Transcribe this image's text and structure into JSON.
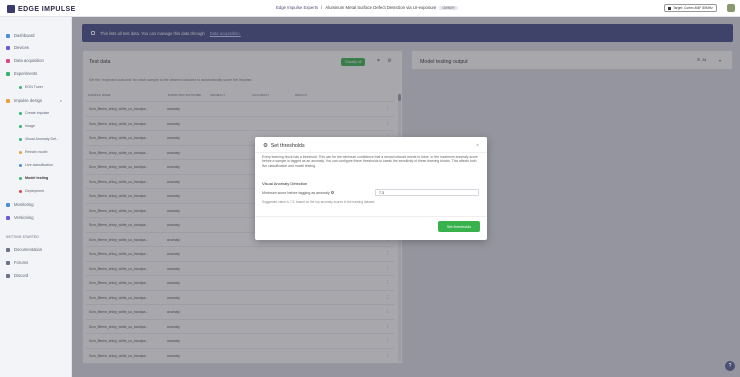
{
  "header": {
    "logo_text": "EDGE IMPULSE",
    "owner": "Edge Impulse Experts",
    "separator": "/",
    "project": "Aluminum Metal Surface Defect Detection via UI-exposure",
    "badge": "OWNER",
    "target": "Target: Cortex-M4F 80MHz"
  },
  "sidebar": {
    "items": [
      {
        "label": "Dashboard",
        "color": "#4a90d9"
      },
      {
        "label": "Devices",
        "color": "#6b5cd6"
      },
      {
        "label": "Data acquisition",
        "color": "#d94a8a"
      },
      {
        "label": "Experiments",
        "color": "#3cb371"
      },
      {
        "label": "EON Tuner",
        "color": "#3cb371"
      },
      {
        "label": "Impulse design",
        "color": "#e8a23c"
      },
      {
        "label": "Monitoring",
        "color": "#4a90d9"
      },
      {
        "label": "Versioning",
        "color": "#6b5cd6"
      },
      {
        "label": "Documentation",
        "color": "#6c7384"
      },
      {
        "label": "Forums",
        "color": "#6c7384"
      },
      {
        "label": "Discord",
        "color": "#6c7384"
      }
    ],
    "subitems": [
      {
        "label": "Create impulse",
        "color": "#3cb371"
      },
      {
        "label": "Image",
        "color": "#3cb371"
      },
      {
        "label": "Visual Anomaly Det...",
        "color": "#3cb371"
      },
      {
        "label": "Retrain model",
        "color": "#e8a23c"
      },
      {
        "label": "Live classification",
        "color": "#4a90d9"
      },
      {
        "label": "Model testing",
        "color": "#3cb371"
      },
      {
        "label": "Deployment",
        "color": "#d94a4a"
      }
    ],
    "section_label": "GETTING STARTED"
  },
  "notice": {
    "text": "This lists all test data. You can manage this data through",
    "link": "Data acquisition."
  },
  "test_panel": {
    "title": "Test data",
    "classify_label": "Classify all",
    "hint": "Set the 'expected outcome' for each sample to the desired outcome to automatically score the impulse.",
    "columns": [
      "SAMPLE NAME",
      "EXPECTED OUTCOME",
      "ANOMALY",
      "ACCURACY",
      "RESULT"
    ],
    "rows": [
      {
        "name": "Scm_filtrem_shiny_white_uu_bandpa...",
        "label": "anomaly"
      },
      {
        "name": "Scm_filtrem_shiny_white_uu_bandpa...",
        "label": "anomaly"
      },
      {
        "name": "Scm_filtrem_shiny_white_uu_bandpa...",
        "label": "anomaly"
      },
      {
        "name": "Scm_filtrem_shiny_white_uu_bandpa...",
        "label": "anomaly"
      },
      {
        "name": "Scm_filtrem_shiny_white_uu_bandpa...",
        "label": "anomaly"
      },
      {
        "name": "Scm_filtrem_shiny_white_uu_bandpa...",
        "label": "anomaly"
      },
      {
        "name": "Scm_filtrem_shiny_white_uu_bandpa...",
        "label": "anomaly"
      },
      {
        "name": "Scm_filtrem_shiny_white_uu_bandpa...",
        "label": "anomaly"
      },
      {
        "name": "Scm_filtrem_shiny_white_uu_bandpa...",
        "label": "anomaly"
      },
      {
        "name": "Scm_filtrem_shiny_white_uu_bandpa...",
        "label": "anomaly"
      },
      {
        "name": "Scm_filtrem_shiny_white_uu_bandpa...",
        "label": "anomaly"
      },
      {
        "name": "Scm_filtrem_shiny_white_uu_bandpa...",
        "label": "anomaly"
      },
      {
        "name": "Scm_filtrem_shiny_white_uu_bandpa...",
        "label": "anomaly"
      },
      {
        "name": "Scm_filtrem_shiny_white_uu_bandpa...",
        "label": "anomaly"
      },
      {
        "name": "Scm_filtrem_shiny_white_uu_bandpa...",
        "label": "anomaly"
      },
      {
        "name": "Scm_filtrem_shiny_white_uu_bandpa...",
        "label": "anomaly"
      },
      {
        "name": "Scm_filtrem_shiny_white_uu_bandpa...",
        "label": "anomaly"
      },
      {
        "name": "Scm_filtrem_shiny_white_uu_bandpa...",
        "label": "anomaly"
      }
    ]
  },
  "output_panel": {
    "title": "Model testing output",
    "rows_select": "All"
  },
  "modal": {
    "title": "Set thresholds",
    "description": "Every learning block has a threshold. This can be the minimum confidence that a neural network needs to have, or the maximum anomaly score before a sample is tagged as an anomaly. You can configure these thresholds to tweak the sensitivity of these learning blocks. This affects both live classification and model testing.",
    "section": "Visual Anomaly Detection",
    "field_label": "Minimum score before tagging as anomaly",
    "field_value": "7.3",
    "field_hint": "Suggested value is 7.3, based on the top anomaly scores in the training dataset.",
    "button": "Set thresholds"
  },
  "help_icon": "?"
}
